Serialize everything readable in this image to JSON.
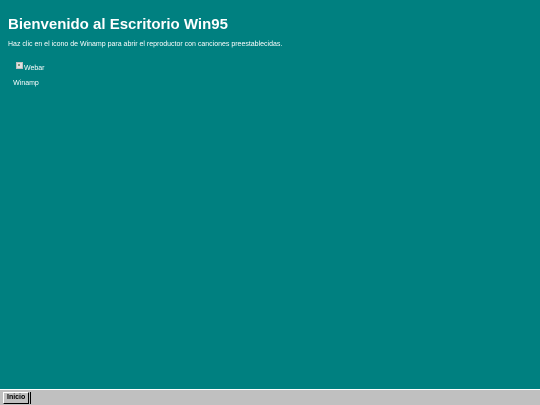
{
  "desktop": {
    "title": "Bienvenido al Escritorio Win95",
    "subtitle": "Haz clic en el icono de Winamp para abrir el reproductor con canciones preestablecidas.",
    "background_color": "#008080"
  },
  "icons": [
    {
      "image_alt": "Webar",
      "label": "Winamp",
      "icon": "winamp-icon"
    }
  ],
  "taskbar": {
    "start_label": "Inicio",
    "background_color": "#c0c0c0"
  }
}
